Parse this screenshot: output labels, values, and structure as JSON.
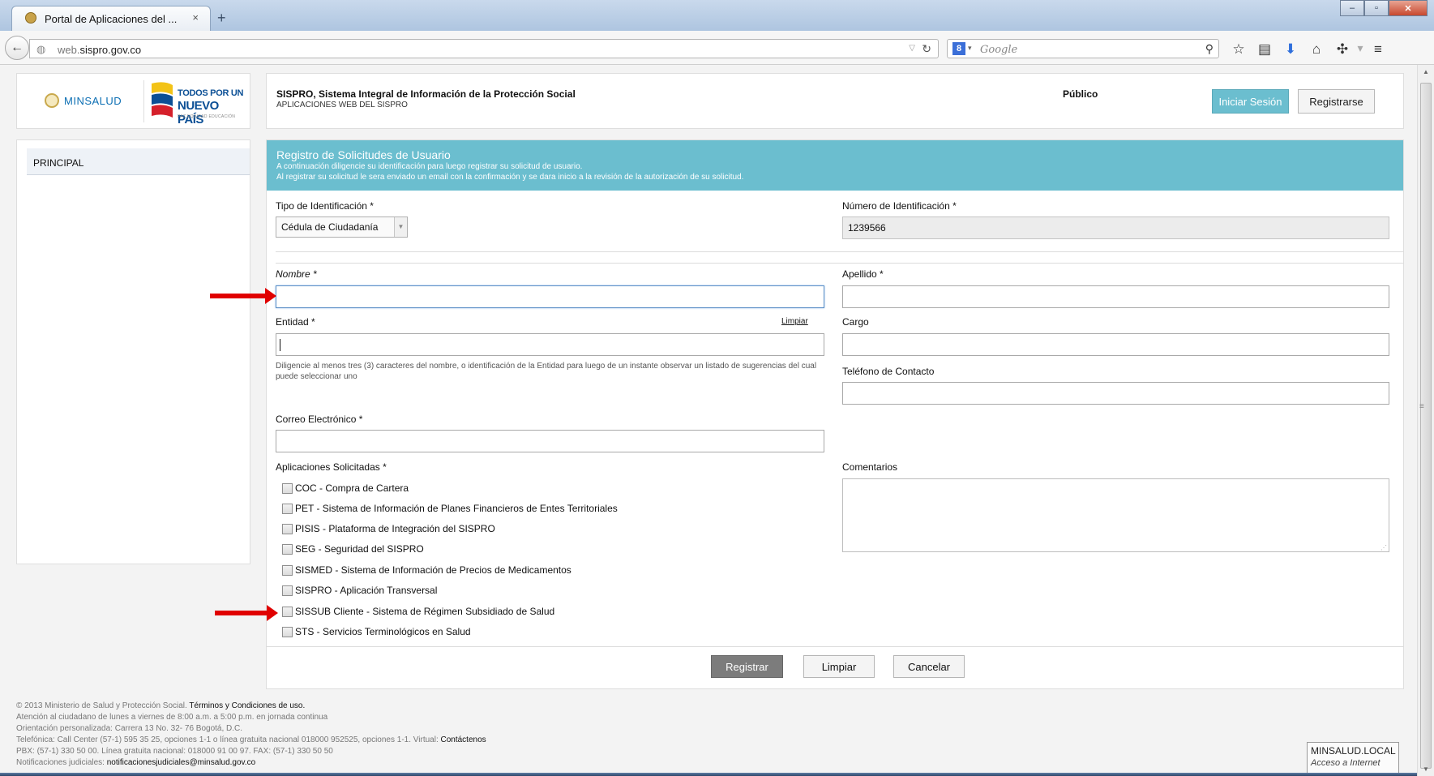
{
  "browser": {
    "tab_title": "Portal de Aplicaciones del ...",
    "tab_close": "×",
    "new_tab": "+",
    "url_prefix": "web.",
    "url_domain": "sispro.gov.co",
    "search_placeholder": "Google",
    "search_engine_letter": "8"
  },
  "logos": {
    "minsalud": "MINSALUD",
    "tpn_line1": "TODOS POR UN",
    "tpn_line2": "NUEVO PAÍS",
    "tpn_line3": "PAZ  EQUIDAD  EDUCACIÓN"
  },
  "header": {
    "title": "SISPRO, Sistema Integral de Información de la Protección Social",
    "subtitle": "APLICACIONES WEB DEL SISPRO",
    "user_status": "Público",
    "login_label": "Iniciar Sesión",
    "register_label": "Registrarse"
  },
  "sidebar": {
    "items": [
      {
        "label": "PRINCIPAL"
      }
    ]
  },
  "form": {
    "heading": "Registro de Solicitudes de Usuario",
    "intro1": "A continuación diligencie su identificación para luego registrar su solicitud de usuario.",
    "intro2": "Al registrar su solicitud le sera enviado un email con la confirmación y se dara inicio a la revisión de la autorización de su solicitud.",
    "id_type_label": "Tipo de Identificación *",
    "id_type_value": "Cédula de Ciudadanía",
    "id_number_label": "Número de Identificación *",
    "id_number_value": "1239566",
    "nombre_label": "Nombre *",
    "nombre_value": "",
    "apellido_label": "Apellido *",
    "apellido_value": "",
    "entidad_label": "Entidad *",
    "entidad_value": "",
    "limpiar_link": "Limpiar",
    "entidad_help": "Diligencie al menos tres (3) caracteres del nombre, o identificación de la Entidad para luego de un instante observar un listado de sugerencias del cual puede seleccionar uno",
    "cargo_label": "Cargo",
    "cargo_value": "",
    "telefono_label": "Teléfono de Contacto",
    "telefono_value": "",
    "correo_label": "Correo Electrónico *",
    "correo_value": "",
    "apps_label": "Aplicaciones Solicitadas *",
    "comentarios_label": "Comentarios",
    "applications": [
      {
        "label": "COC - Compra de Cartera",
        "checked": false
      },
      {
        "label": "PET - Sistema de Información de Planes Financieros de Entes Territoriales",
        "checked": false
      },
      {
        "label": "PISIS - Plataforma de Integración del SISPRO",
        "checked": false
      },
      {
        "label": "SEG - Seguridad del SISPRO",
        "checked": false
      },
      {
        "label": "SISMED - Sistema de Información de Precios de Medicamentos",
        "checked": false
      },
      {
        "label": "SISPRO - Aplicación Transversal",
        "checked": false
      },
      {
        "label": "SISSUB Cliente - Sistema de Régimen Subsidiado de Salud",
        "checked": false
      },
      {
        "label": "STS - Servicios Terminológicos en Salud",
        "checked": false
      }
    ],
    "buttons": {
      "registrar": "Registrar",
      "limpiar": "Limpiar",
      "cancelar": "Cancelar"
    }
  },
  "footer": {
    "copyright": "© 2013 Ministerio de Salud y Protección Social.",
    "terms": "Términos y Condiciones de uso.",
    "line2": "Atención al ciudadano de lunes a viernes de 8:00 a.m. a 5:00 p.m. en jornada continua",
    "line3": "Orientación personalizada: Carrera 13 No. 32- 76 Bogotá, D.C.",
    "line4": "Telefónica: Call Center (57-1) 595 35 25, opciones 1-1 o línea gratuita nacional 018000 952525, opciones 1-1. Virtual:",
    "contact": "Contáctenos",
    "line5": "PBX: (57-1) 330 50 00. Línea gratuita nacional: 018000 91 00 97. FAX: (57-1) 330 50 50",
    "line6_prefix": "Notificaciones judiciales:",
    "line6_email": "notificacionesjudiciales@minsalud.gov.co"
  },
  "network_badge": {
    "line1": "MINSALUD.LOCAL",
    "line2": "Acceso a Internet"
  },
  "colors": {
    "accent": "#6bbecf",
    "annotation_arrow": "#e00000"
  },
  "icons": [
    "favicon-icon",
    "back-arrow-icon",
    "globe-icon",
    "reload-icon",
    "search-icon",
    "star-icon",
    "bookmarks-icon",
    "download-icon",
    "home-icon",
    "addon-icon",
    "menu-icon"
  ]
}
